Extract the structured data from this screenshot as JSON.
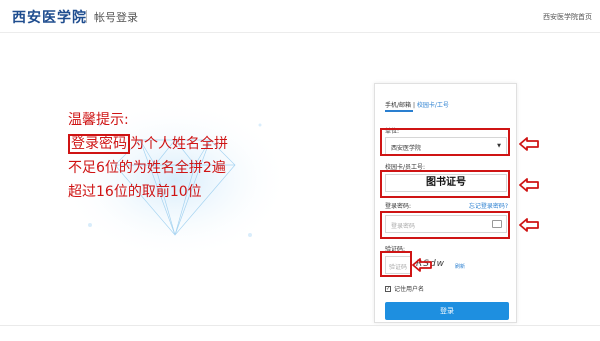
{
  "header": {
    "logo": "西安医学院",
    "subtitle": "帐号登录",
    "home_link": "西安医学院首页"
  },
  "tips": {
    "line1": "温馨提示:",
    "line2_boxed": "登录密码",
    "line2_rest": "为个人姓名全拼",
    "line3": "不足6位的为姓名全拼2遍",
    "line4": "超过16位的取前10位"
  },
  "login": {
    "tab_phone_email": "手机/邮箱",
    "tab_separator": " | ",
    "tab_card": "校园卡/工号",
    "unit_label": "单位:",
    "unit_value": "西安医学院",
    "card_label": "校园卡/员工号:",
    "card_value": "图书证号",
    "password_label": "登录密码:",
    "forgot_link": "忘记登录密码?",
    "password_placeholder": "登录密码",
    "captcha_label": "验证码:",
    "captcha_placeholder": "验证码",
    "captcha_text": "RSdw",
    "refresh_link": "刷新",
    "remember_label": "记住用户名",
    "login_button": "登录"
  },
  "colors": {
    "brand": "#1f4d8f",
    "accent": "#1e8fe0",
    "annotation_red": "#cf1414",
    "link": "#2a7fd0"
  },
  "icons": [
    "caret-down-icon",
    "keyboard-icon",
    "checkbox-checked-icon",
    "left-arrow-annotation-icon"
  ]
}
